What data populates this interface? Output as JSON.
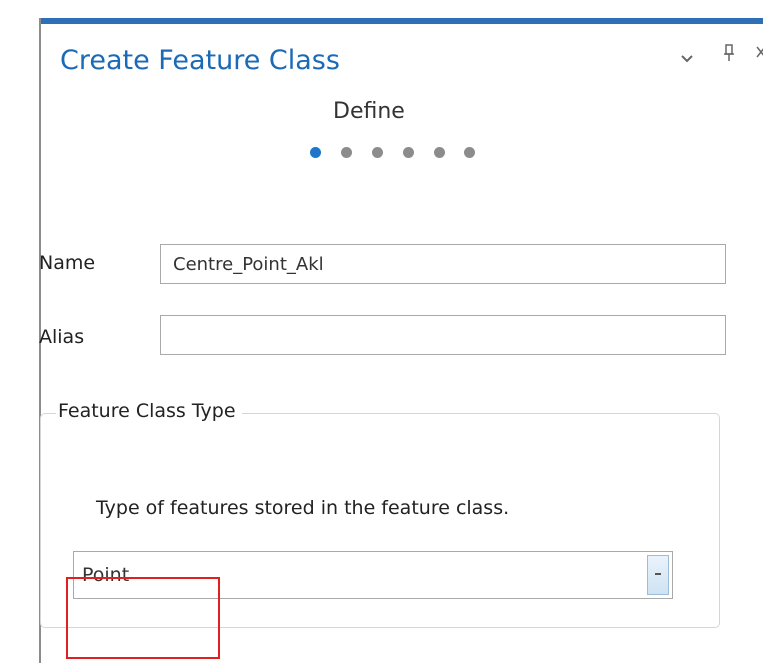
{
  "pane": {
    "title": "Create Feature Class",
    "options_glyph": "▾",
    "pin_glyph": "📌",
    "close_glyph": "✕",
    "accent_color": "#2f6fb5"
  },
  "wizard": {
    "step_title": "Define",
    "total_steps": 6,
    "current_step": 1
  },
  "form": {
    "name_label": "Name",
    "name_value": "Centre_Point_Akl",
    "alias_label": "Alias",
    "alias_value": ""
  },
  "feature_class_type": {
    "legend": "Feature Class Type",
    "description": "Type of features stored in the feature class.",
    "selected": "Point"
  },
  "colors": {
    "title_text": "#1a6ab6",
    "active_dot": "#1f75c9",
    "inactive_dot": "#8c8c8c",
    "highlight": "#e02020"
  }
}
